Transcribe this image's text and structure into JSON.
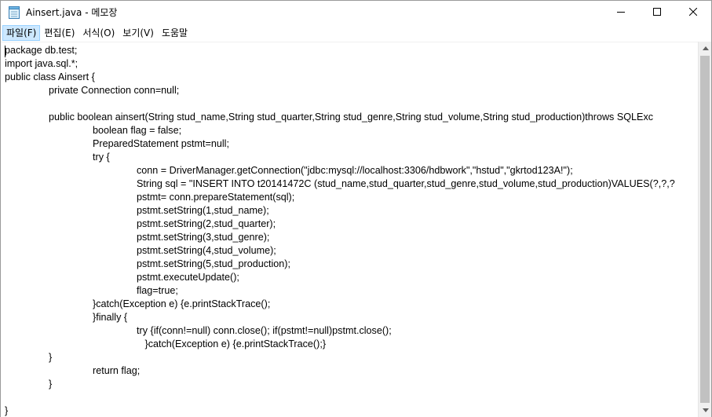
{
  "window": {
    "title": "Ainsert.java - 메모장"
  },
  "menu": {
    "file": "파일(F)",
    "edit": "편집(E)",
    "format": "서식(O)",
    "view": "보기(V)",
    "help": "도움말"
  },
  "code": {
    "lines": [
      "package db.test;",
      "import java.sql.*;",
      "public class Ainsert {",
      "\t\tprivate Connection conn=null;",
      "",
      "\t\tpublic boolean ainsert(String stud_name,String stud_quarter,String stud_genre,String stud_volume,String stud_production)throws SQLExc",
      "\t\t\t\tboolean flag = false;",
      "\t\t\t\tPreparedStatement pstmt=null;",
      "\t\t\t\ttry {",
      "\t\t\t\t\t\tconn = DriverManager.getConnection(\"jdbc:mysql://localhost:3306/hdbwork\",\"hstud\",\"gkrtod123A!\");",
      "\t\t\t\t\t\tString sql = \"INSERT INTO t20141472C (stud_name,stud_quarter,stud_genre,stud_volume,stud_production)VALUES(?,?,?",
      "\t\t\t\t\t\tpstmt= conn.prepareStatement(sql);",
      "\t\t\t\t\t\tpstmt.setString(1,stud_name);",
      "\t\t\t\t\t\tpstmt.setString(2,stud_quarter);",
      "\t\t\t\t\t\tpstmt.setString(3,stud_genre);",
      "\t\t\t\t\t\tpstmt.setString(4,stud_volume);",
      "\t\t\t\t\t\tpstmt.setString(5,stud_production);",
      "\t\t\t\t\t\tpstmt.executeUpdate();",
      "\t\t\t\t\t\tflag=true;",
      "\t\t\t\t}catch(Exception e) {e.printStackTrace();",
      "\t\t\t\t}finally {",
      "\t\t\t\t\t\ttry {if(conn!=null) conn.close(); if(pstmt!=null)pstmt.close();",
      "\t\t\t\t\t\t   }catch(Exception e) {e.printStackTrace();}",
      "\t\t}",
      "\t\t\t\treturn flag;",
      "\t\t}",
      "",
      "}"
    ]
  },
  "icons": {
    "app": "notepad-icon",
    "minimize": "minimize-icon",
    "maximize": "maximize-icon",
    "close": "close-icon"
  }
}
